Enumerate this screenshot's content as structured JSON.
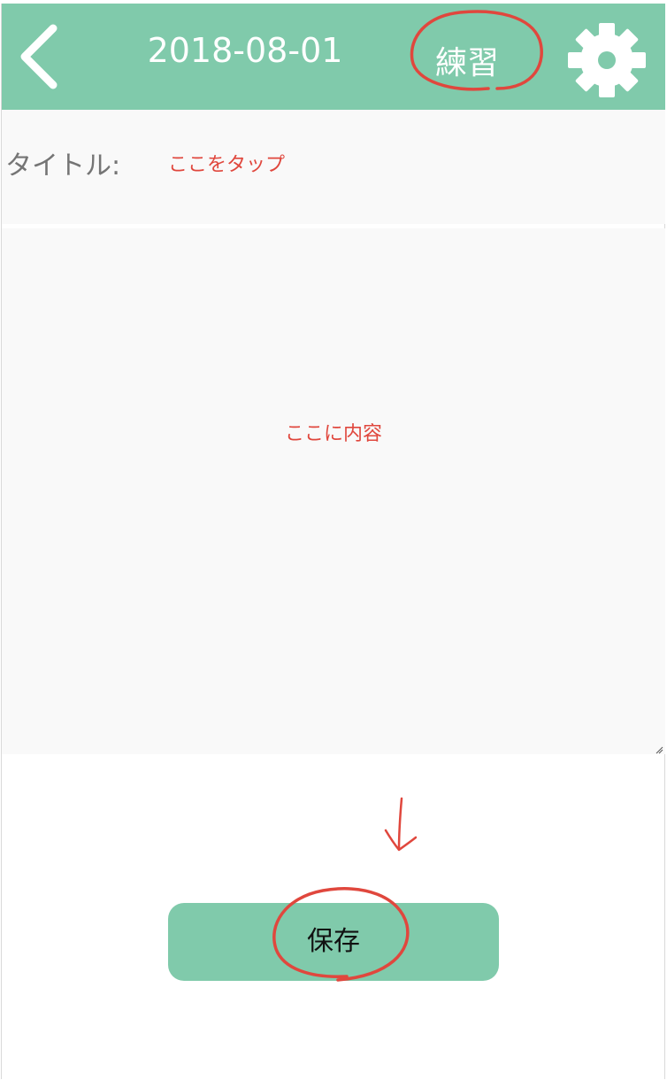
{
  "header": {
    "date": "2018-08-01",
    "mode_label": "練習",
    "back_icon": "chevron-left-icon",
    "settings_icon": "gear-icon"
  },
  "title_row": {
    "label": "タイトル:",
    "placeholder": "ここをタップ"
  },
  "content": {
    "placeholder": "ここに内容"
  },
  "save_button": {
    "label": "保存"
  },
  "colors": {
    "accent": "#80caab",
    "annotation": "#e0473d",
    "panel": "#f9f9f9"
  }
}
